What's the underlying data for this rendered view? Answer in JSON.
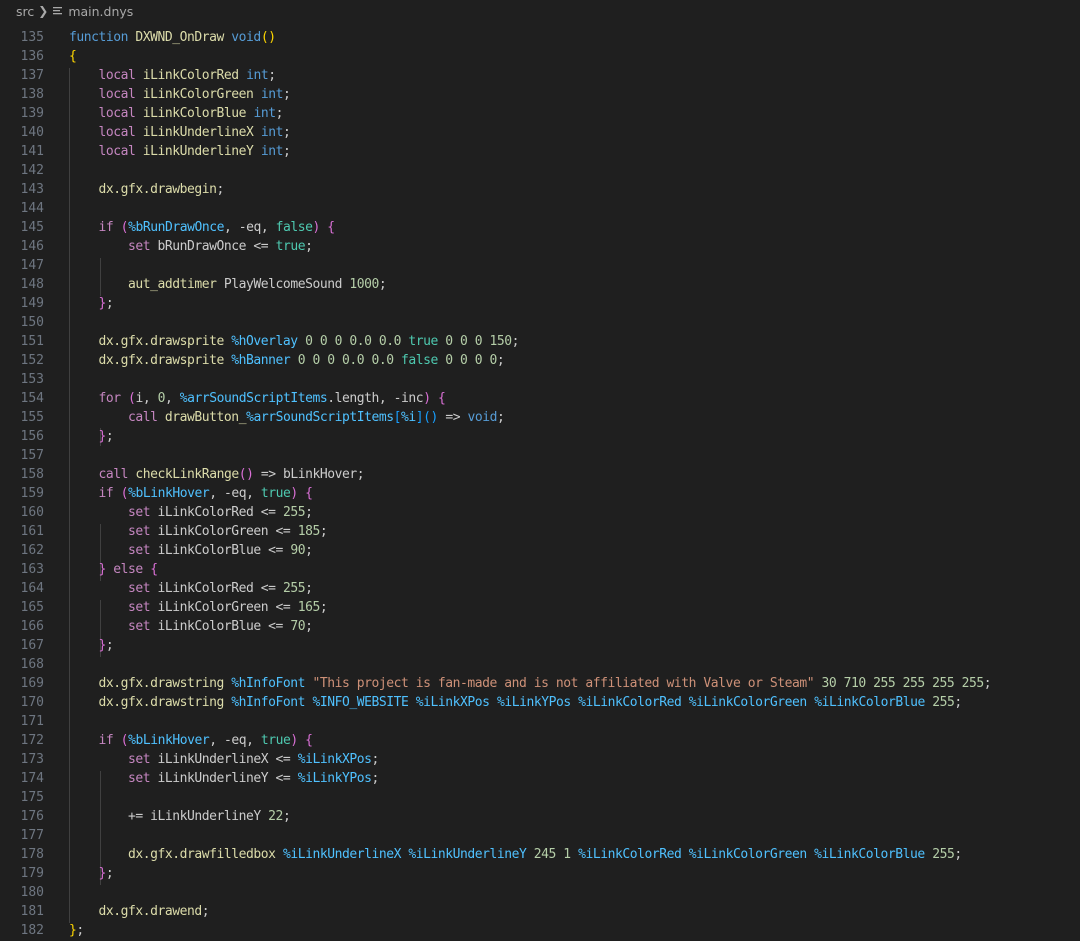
{
  "breadcrumb": {
    "folder": "src",
    "file": "main.dnys"
  },
  "colors": {
    "background": "#1f1f1f",
    "keyword": "#c586c0",
    "type": "#569cd6",
    "function": "#dcdcaa",
    "variable": "#4fc1ff",
    "string": "#ce9178",
    "number": "#b5cea8",
    "line_number": "#6e7681"
  },
  "lines": [
    {
      "n": "135",
      "t": [
        [
          "function",
          "c"
        ],
        [
          " DXWND_OnDraw ",
          "f"
        ],
        [
          "void",
          "c"
        ],
        [
          "()",
          "b1"
        ]
      ]
    },
    {
      "n": "136",
      "t": [
        [
          "{",
          "b1"
        ]
      ]
    },
    {
      "n": "137",
      "t": [
        [
          "    "
        ],
        [
          "local",
          "k"
        ],
        [
          " iLinkColorRed ",
          "f"
        ],
        [
          "int",
          "c"
        ],
        [
          ";"
        ]
      ]
    },
    {
      "n": "138",
      "t": [
        [
          "    "
        ],
        [
          "local",
          "k"
        ],
        [
          " iLinkColorGreen ",
          "f"
        ],
        [
          "int",
          "c"
        ],
        [
          ";"
        ]
      ]
    },
    {
      "n": "139",
      "t": [
        [
          "    "
        ],
        [
          "local",
          "k"
        ],
        [
          " iLinkColorBlue ",
          "f"
        ],
        [
          "int",
          "c"
        ],
        [
          ";"
        ]
      ]
    },
    {
      "n": "140",
      "t": [
        [
          "    "
        ],
        [
          "local",
          "k"
        ],
        [
          " iLinkUnderlineX ",
          "f"
        ],
        [
          "int",
          "c"
        ],
        [
          ";"
        ]
      ]
    },
    {
      "n": "141",
      "t": [
        [
          "    "
        ],
        [
          "local",
          "k"
        ],
        [
          " iLinkUnderlineY ",
          "f"
        ],
        [
          "int",
          "c"
        ],
        [
          ";"
        ]
      ]
    },
    {
      "n": "142",
      "t": []
    },
    {
      "n": "143",
      "t": [
        [
          "    "
        ],
        [
          "dx.gfx.drawbegin",
          "f"
        ],
        [
          ";"
        ]
      ]
    },
    {
      "n": "144",
      "t": []
    },
    {
      "n": "145",
      "t": [
        [
          "    "
        ],
        [
          "if",
          "k"
        ],
        [
          " "
        ],
        [
          "(",
          "b2"
        ],
        [
          "%bRunDrawOnce",
          "v"
        ],
        [
          ", -eq, "
        ],
        [
          "false",
          "g"
        ],
        [
          ")",
          "b2"
        ],
        [
          " "
        ],
        [
          "{",
          "b2"
        ]
      ]
    },
    {
      "n": "146",
      "t": [
        [
          "        "
        ],
        [
          "set",
          "k"
        ],
        [
          " bRunDrawOnce <= "
        ],
        [
          "true",
          "g"
        ],
        [
          ";"
        ]
      ]
    },
    {
      "n": "147",
      "t": []
    },
    {
      "n": "148",
      "t": [
        [
          "        "
        ],
        [
          "aut_addtimer",
          "f"
        ],
        [
          " PlayWelcomeSound "
        ],
        [
          "1000",
          "n"
        ],
        [
          ";"
        ]
      ]
    },
    {
      "n": "149",
      "t": [
        [
          "    "
        ],
        [
          "}",
          "b2"
        ],
        [
          ";"
        ]
      ]
    },
    {
      "n": "150",
      "t": []
    },
    {
      "n": "151",
      "t": [
        [
          "    "
        ],
        [
          "dx.gfx.drawsprite ",
          "f"
        ],
        [
          "%hOverlay",
          "v"
        ],
        [
          " "
        ],
        [
          "0 0 0 0.0 0.0",
          "n"
        ],
        [
          " "
        ],
        [
          "true",
          "g"
        ],
        [
          " "
        ],
        [
          "0 0 0 150",
          "n"
        ],
        [
          ";"
        ]
      ]
    },
    {
      "n": "152",
      "t": [
        [
          "    "
        ],
        [
          "dx.gfx.drawsprite ",
          "f"
        ],
        [
          "%hBanner",
          "v"
        ],
        [
          " "
        ],
        [
          "0 0 0 0.0 0.0",
          "n"
        ],
        [
          " "
        ],
        [
          "false",
          "g"
        ],
        [
          " "
        ],
        [
          "0 0 0 0",
          "n"
        ],
        [
          ";"
        ]
      ]
    },
    {
      "n": "153",
      "t": []
    },
    {
      "n": "154",
      "t": [
        [
          "    "
        ],
        [
          "for",
          "k"
        ],
        [
          " "
        ],
        [
          "(",
          "b2"
        ],
        [
          "i, "
        ],
        [
          "0",
          "n"
        ],
        [
          ", "
        ],
        [
          "%arrSoundScriptItems",
          "v"
        ],
        [
          ".length, -inc"
        ],
        [
          ")",
          "b2"
        ],
        [
          " "
        ],
        [
          "{",
          "b2"
        ]
      ]
    },
    {
      "n": "155",
      "t": [
        [
          "        "
        ],
        [
          "call",
          "k"
        ],
        [
          " "
        ],
        [
          "drawButton_",
          "f"
        ],
        [
          "%arrSoundScriptItems",
          "v"
        ],
        [
          "[",
          "b3"
        ],
        [
          "%i",
          "v"
        ],
        [
          "]",
          "b3"
        ],
        [
          "()",
          "b3"
        ],
        [
          " => "
        ],
        [
          "void",
          "c"
        ],
        [
          ";"
        ]
      ]
    },
    {
      "n": "156",
      "t": [
        [
          "    "
        ],
        [
          "}",
          "b2"
        ],
        [
          ";"
        ]
      ]
    },
    {
      "n": "157",
      "t": []
    },
    {
      "n": "158",
      "t": [
        [
          "    "
        ],
        [
          "call",
          "k"
        ],
        [
          " "
        ],
        [
          "checkLinkRange",
          "f"
        ],
        [
          "()",
          "b2"
        ],
        [
          " => bLinkHover;"
        ]
      ]
    },
    {
      "n": "159",
      "t": [
        [
          "    "
        ],
        [
          "if",
          "k"
        ],
        [
          " "
        ],
        [
          "(",
          "b2"
        ],
        [
          "%bLinkHover",
          "v"
        ],
        [
          ", -eq, "
        ],
        [
          "true",
          "g"
        ],
        [
          ")",
          "b2"
        ],
        [
          " "
        ],
        [
          "{",
          "b2"
        ]
      ]
    },
    {
      "n": "160",
      "t": [
        [
          "        "
        ],
        [
          "set",
          "k"
        ],
        [
          " iLinkColorRed <= "
        ],
        [
          "255",
          "n"
        ],
        [
          ";"
        ]
      ]
    },
    {
      "n": "161",
      "t": [
        [
          "        "
        ],
        [
          "set",
          "k"
        ],
        [
          " iLinkColorGreen <= "
        ],
        [
          "185",
          "n"
        ],
        [
          ";"
        ]
      ]
    },
    {
      "n": "162",
      "t": [
        [
          "        "
        ],
        [
          "set",
          "k"
        ],
        [
          " iLinkColorBlue <= "
        ],
        [
          "90",
          "n"
        ],
        [
          ";"
        ]
      ]
    },
    {
      "n": "163",
      "t": [
        [
          "    "
        ],
        [
          "}",
          "b2"
        ],
        [
          " "
        ],
        [
          "else",
          "k"
        ],
        [
          " "
        ],
        [
          "{",
          "b2"
        ]
      ]
    },
    {
      "n": "164",
      "t": [
        [
          "        "
        ],
        [
          "set",
          "k"
        ],
        [
          " iLinkColorRed <= "
        ],
        [
          "255",
          "n"
        ],
        [
          ";"
        ]
      ]
    },
    {
      "n": "165",
      "t": [
        [
          "        "
        ],
        [
          "set",
          "k"
        ],
        [
          " iLinkColorGreen <= "
        ],
        [
          "165",
          "n"
        ],
        [
          ";"
        ]
      ]
    },
    {
      "n": "166",
      "t": [
        [
          "        "
        ],
        [
          "set",
          "k"
        ],
        [
          " iLinkColorBlue <= "
        ],
        [
          "70",
          "n"
        ],
        [
          ";"
        ]
      ]
    },
    {
      "n": "167",
      "t": [
        [
          "    "
        ],
        [
          "}",
          "b2"
        ],
        [
          ";"
        ]
      ]
    },
    {
      "n": "168",
      "t": []
    },
    {
      "n": "169",
      "t": [
        [
          "    "
        ],
        [
          "dx.gfx.drawstring ",
          "f"
        ],
        [
          "%hInfoFont",
          "v"
        ],
        [
          " "
        ],
        [
          "\"This project is fan-made and is not affiliated with Valve or Steam\"",
          "s"
        ],
        [
          " "
        ],
        [
          "30 710 255 255 255 255",
          "n"
        ],
        [
          ";"
        ]
      ]
    },
    {
      "n": "170",
      "t": [
        [
          "    "
        ],
        [
          "dx.gfx.drawstring ",
          "f"
        ],
        [
          "%hInfoFont",
          "v"
        ],
        [
          " "
        ],
        [
          "%INFO_WEBSITE",
          "v"
        ],
        [
          " "
        ],
        [
          "%iLinkXPos",
          "v"
        ],
        [
          " "
        ],
        [
          "%iLinkYPos",
          "v"
        ],
        [
          " "
        ],
        [
          "%iLinkColorRed",
          "v"
        ],
        [
          " "
        ],
        [
          "%iLinkColorGreen",
          "v"
        ],
        [
          " "
        ],
        [
          "%iLinkColorBlue",
          "v"
        ],
        [
          " "
        ],
        [
          "255",
          "n"
        ],
        [
          ";"
        ]
      ]
    },
    {
      "n": "171",
      "t": []
    },
    {
      "n": "172",
      "t": [
        [
          "    "
        ],
        [
          "if",
          "k"
        ],
        [
          " "
        ],
        [
          "(",
          "b2"
        ],
        [
          "%bLinkHover",
          "v"
        ],
        [
          ", -eq, "
        ],
        [
          "true",
          "g"
        ],
        [
          ")",
          "b2"
        ],
        [
          " "
        ],
        [
          "{",
          "b2"
        ]
      ]
    },
    {
      "n": "173",
      "t": [
        [
          "        "
        ],
        [
          "set",
          "k"
        ],
        [
          " iLinkUnderlineX <= "
        ],
        [
          "%iLinkXPos",
          "v"
        ],
        [
          ";"
        ]
      ]
    },
    {
      "n": "174",
      "t": [
        [
          "        "
        ],
        [
          "set",
          "k"
        ],
        [
          " iLinkUnderlineY <= "
        ],
        [
          "%iLinkYPos",
          "v"
        ],
        [
          ";"
        ]
      ]
    },
    {
      "n": "175",
      "t": []
    },
    {
      "n": "176",
      "t": [
        [
          "        += iLinkUnderlineY "
        ],
        [
          "22",
          "n"
        ],
        [
          ";"
        ]
      ]
    },
    {
      "n": "177",
      "t": []
    },
    {
      "n": "178",
      "t": [
        [
          "        "
        ],
        [
          "dx.gfx.drawfilledbox ",
          "f"
        ],
        [
          "%iLinkUnderlineX",
          "v"
        ],
        [
          " "
        ],
        [
          "%iLinkUnderlineY",
          "v"
        ],
        [
          " "
        ],
        [
          "245 1",
          "n"
        ],
        [
          " "
        ],
        [
          "%iLinkColorRed",
          "v"
        ],
        [
          " "
        ],
        [
          "%iLinkColorGreen",
          "v"
        ],
        [
          " "
        ],
        [
          "%iLinkColorBlue",
          "v"
        ],
        [
          " "
        ],
        [
          "255",
          "n"
        ],
        [
          ";"
        ]
      ]
    },
    {
      "n": "179",
      "t": [
        [
          "    "
        ],
        [
          "}",
          "b2"
        ],
        [
          ";"
        ]
      ]
    },
    {
      "n": "180",
      "t": []
    },
    {
      "n": "181",
      "t": [
        [
          "    "
        ],
        [
          "dx.gfx.drawend",
          "f"
        ],
        [
          ";"
        ]
      ]
    },
    {
      "n": "182",
      "t": [
        [
          "}",
          "b1"
        ],
        [
          ";"
        ]
      ]
    }
  ]
}
